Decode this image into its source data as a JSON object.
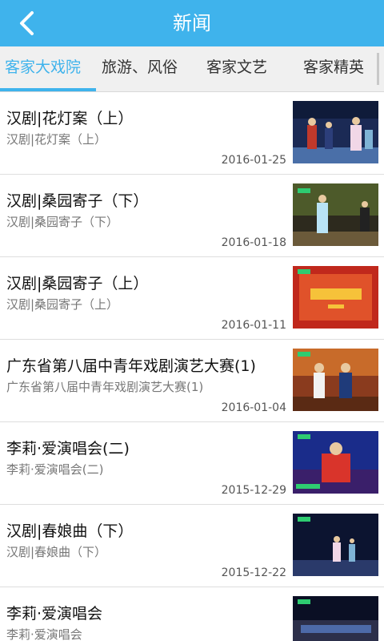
{
  "header": {
    "title": "新闻"
  },
  "tabs": [
    {
      "label": "客家大戏院"
    },
    {
      "label": "旅游、风俗"
    },
    {
      "label": "客家文艺"
    },
    {
      "label": "客家精英"
    }
  ],
  "news": [
    {
      "title": "汉剧|花灯案（上）",
      "subtitle": "汉剧|花灯案（上）",
      "date": "2016-01-25"
    },
    {
      "title": "汉剧|桑园寄子（下）",
      "subtitle": "汉剧|桑园寄子（下）",
      "date": "2016-01-18"
    },
    {
      "title": "汉剧|桑园寄子（上）",
      "subtitle": "汉剧|桑园寄子（上）",
      "date": "2016-01-11"
    },
    {
      "title": "广东省第八届中青年戏剧演艺大赛(1)",
      "subtitle": "广东省第八届中青年戏剧演艺大赛(1)",
      "date": "2016-01-04"
    },
    {
      "title": "李莉·爱演唱会(二)",
      "subtitle": "李莉·爱演唱会(二)",
      "date": "2015-12-29"
    },
    {
      "title": "汉剧|春娘曲（下）",
      "subtitle": "汉剧|春娘曲（下）",
      "date": "2015-12-22"
    },
    {
      "title": "李莉·爱演唱会",
      "subtitle": "李莉·爱演唱会",
      "date": ""
    }
  ],
  "thumbnails": [
    {
      "subject": "opera-stage-scene"
    },
    {
      "subject": "opera-performer-garden"
    },
    {
      "subject": "title-card-sangyuanjizi"
    },
    {
      "subject": "comedy-duo-stage"
    },
    {
      "subject": "singer-on-stage"
    },
    {
      "subject": "opera-stage-wide"
    },
    {
      "subject": "concert-stage"
    }
  ]
}
